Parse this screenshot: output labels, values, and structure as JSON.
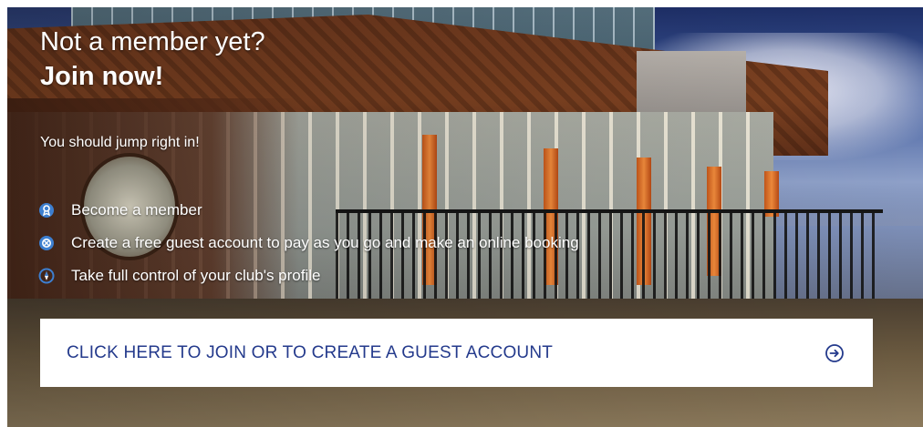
{
  "hero": {
    "title_line1": "Not a member yet?",
    "title_line2": "Join now!",
    "intro": "You should jump right in!"
  },
  "features": [
    {
      "icon": "member-badge-icon",
      "label": "Become a member"
    },
    {
      "icon": "guest-account-icon",
      "label": "Create a free guest account to pay as you go and make an online booking"
    },
    {
      "icon": "compass-icon",
      "label": "Take full control of your club's profile"
    }
  ],
  "cta": {
    "label": "CLICK HERE TO JOIN OR TO CREATE A GUEST ACCOUNT",
    "icon": "arrow-right-circle-icon"
  },
  "colors": {
    "cta_text": "#243a8c",
    "icon_blue": "#3d7fd0",
    "cta_background": "#ffffff"
  }
}
